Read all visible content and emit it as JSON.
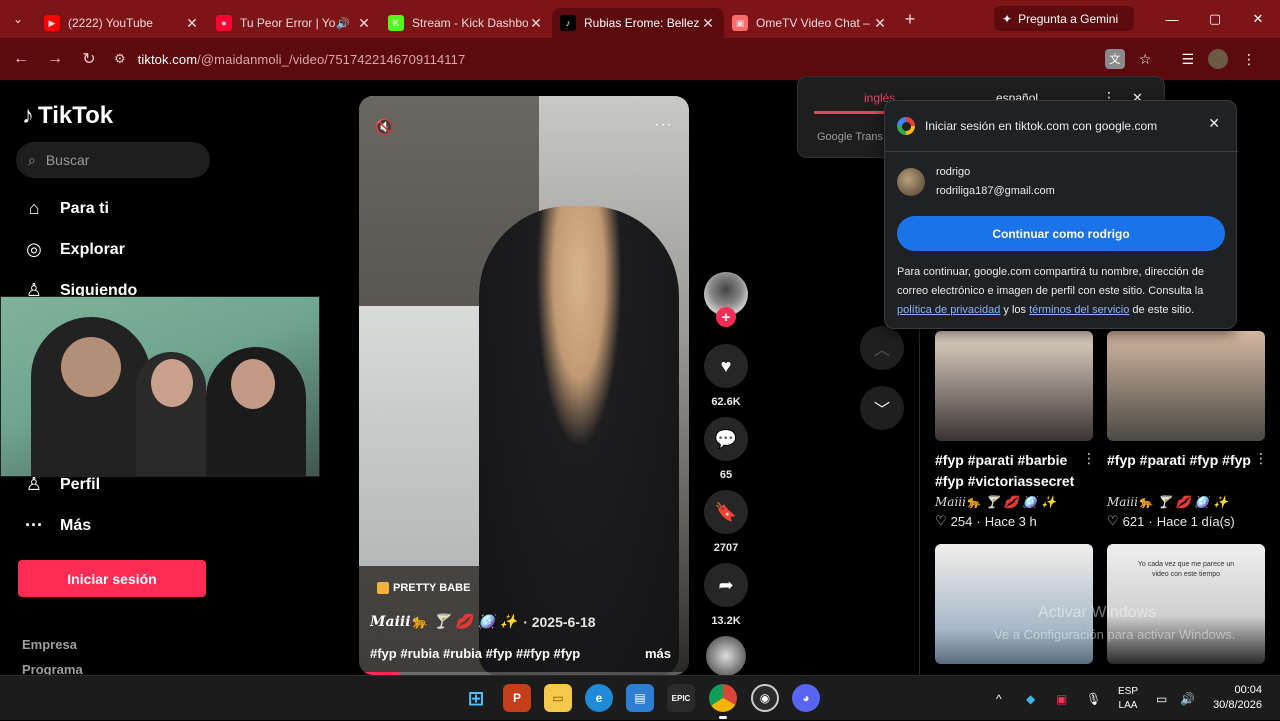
{
  "browser": {
    "tabs": [
      {
        "title": "(2222) YouTube",
        "favicon_color": "#ff0000",
        "favicon_glyph": "▶",
        "active": false,
        "audio": false
      },
      {
        "title": "Tu Peor Error | You",
        "favicon_color": "#ff0033",
        "favicon_glyph": "●",
        "active": false,
        "audio": true
      },
      {
        "title": "Stream - Kick Dashbo",
        "favicon_color": "#53fc18",
        "favicon_glyph": "K",
        "active": false,
        "audio": false
      },
      {
        "title": "Rubias Erome: Belleza",
        "favicon_color": "#000000",
        "favicon_glyph": "♪",
        "active": true,
        "audio": false
      },
      {
        "title": "OmeTV Video Chat –",
        "favicon_color": "#ff6b6b",
        "favicon_glyph": "▣",
        "active": false,
        "audio": false
      }
    ],
    "gemini_label": "Pregunta a Gemini",
    "url_host": "tiktok.com",
    "url_path": "/@maidanmoli_/video/7517422146709114117",
    "theme_color": "#7d1418"
  },
  "sidebar": {
    "logo_text": "TikTok",
    "search_placeholder": "Buscar",
    "items": [
      {
        "label": "Para ti",
        "icon": "home-icon"
      },
      {
        "label": "Explorar",
        "icon": "compass-icon"
      },
      {
        "label": "Siguiendo",
        "icon": "person-icon"
      },
      {
        "label": "Perfil",
        "icon": "profile-icon"
      },
      {
        "label": "Más",
        "icon": "more-dots-icon"
      }
    ],
    "login_label": "Iniciar sesión",
    "footer": [
      "Empresa",
      "Programa"
    ],
    "accent": "#fe2c55"
  },
  "video": {
    "badge": "PRETTY BABE",
    "author": "Maiii🐆 🍸 💋 🪩 ✨",
    "date": "· 2025-6-18",
    "tags": "#fyp #rubia #rubia #fyp ##fyp #fyp",
    "more_label": "más",
    "progress": 0.12
  },
  "actions": {
    "likes": "62.6K",
    "comments": "65",
    "saves": "2707",
    "shares": "13.2K"
  },
  "related": [
    {
      "title": "#fyp #parati #barbie #fyp #victoriassecret",
      "user": "Maiii🐆 🍸 💋 🪩 ✨",
      "likes": "254",
      "time": "Hace 3 h"
    },
    {
      "title": "#fyp #parati #fyp #fyp",
      "user": "Maiii🐆 🍸 💋 🪩 ✨",
      "likes": "621",
      "time": "Hace 1 día(s)"
    }
  ],
  "thumb_text": "Yo cada vez que me parece un video con este tiempo",
  "translate": {
    "lang_from": "inglés",
    "lang_to": "español",
    "brand": "Google Trans"
  },
  "google_signin": {
    "title": "Iniciar sesión en tiktok.com con google.com",
    "name": "rodrigo",
    "email": "rodriliga187@gmail.com",
    "button": "Continuar como rodrigo",
    "legal_1": "Para continuar, google.com compartirá tu nombre, dirección de correo electrónico e imagen de perfil con este sitio. Consulta la",
    "privacy_link": "política de privacidad",
    "legal_2": "y los",
    "terms_link": "términos del servicio",
    "legal_3": "de este sitio."
  },
  "watermark": {
    "line1": "Activar Windows",
    "line2": "Ve a Configuración para activar Windows."
  },
  "taskbar": {
    "lang_line1": "ESP",
    "lang_line2": "LAA",
    "time": "00:04",
    "date": "30/8/2026"
  }
}
